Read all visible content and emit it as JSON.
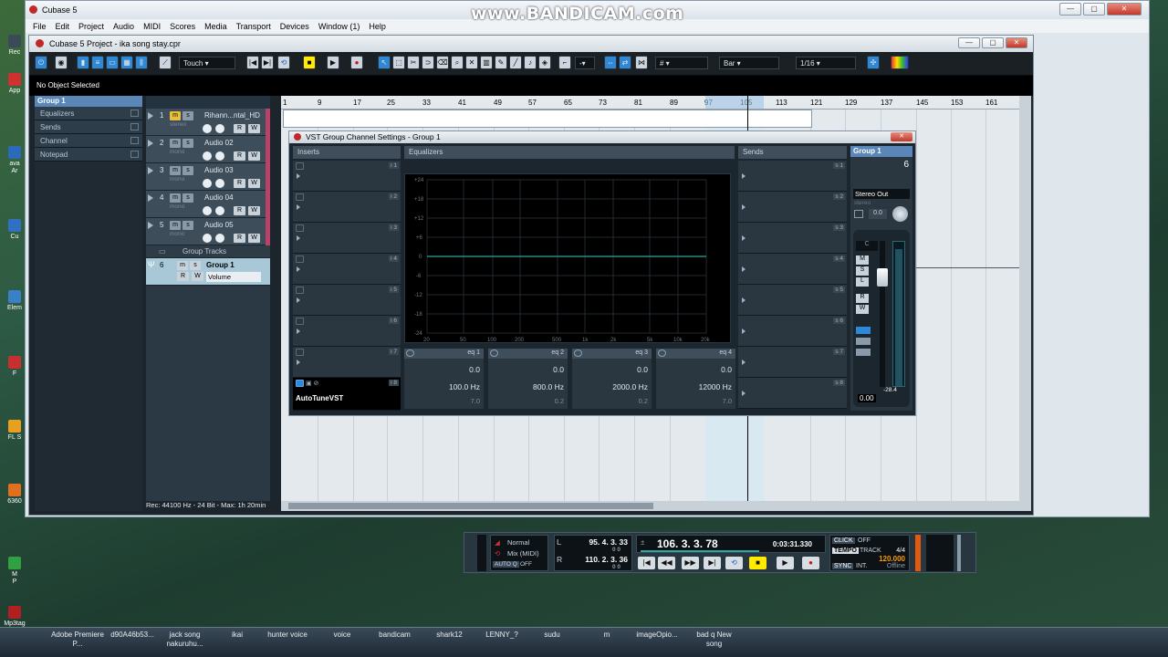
{
  "watermark": "www.BANDICAM.com",
  "app": {
    "title": "Cubase 5",
    "menu": [
      "File",
      "Edit",
      "Project",
      "Audio",
      "MIDI",
      "Scores",
      "Media",
      "Transport",
      "Devices",
      "Window (1)",
      "Help"
    ]
  },
  "desktop": {
    "labels": [
      "Rec",
      "App",
      "ava",
      "Ar",
      "Cu",
      "Elem",
      "F",
      "FL S",
      "6360",
      "M",
      "P",
      "Mp3tag"
    ]
  },
  "taskbar": [
    "Adobe Premiere P...",
    "d90A46b53...",
    "jack song nakuruhu...",
    "ikai",
    "hunter voice",
    "voice",
    "bandicam",
    "shark12",
    "LENNY_?",
    "sudu",
    "m",
    "imageOpio...",
    "bad q New song"
  ],
  "project": {
    "title": "Cubase 5 Project - ika song stay.cpr",
    "toolbar": {
      "automation_mode": "Touch",
      "grid_type": "Bar",
      "quantize": "1/16",
      "snap_value": "-"
    },
    "info_line": "No Object Selected",
    "inspector": {
      "header": "Group 1",
      "rows": [
        "Equalizers",
        "Sends",
        "Channel",
        "Notepad"
      ]
    },
    "status": "Rec: 44100 Hz - 24 Bit - Max: 1h 20min",
    "tracks": [
      {
        "num": "1",
        "name": "Rihann...ntal_HD",
        "type": "stereo"
      },
      {
        "num": "2",
        "name": "Audio 02",
        "type": "mono"
      },
      {
        "num": "3",
        "name": "Audio 03",
        "type": "mono"
      },
      {
        "num": "4",
        "name": "Audio 04",
        "type": "mono"
      },
      {
        "num": "5",
        "name": "Audio 05",
        "type": "mono"
      }
    ],
    "folder": "Group Tracks",
    "group_track": {
      "num": "6",
      "name": "Group 1",
      "param": "Volume"
    },
    "ruler": [
      "1",
      "9",
      "17",
      "25",
      "33",
      "41",
      "49",
      "57",
      "65",
      "73",
      "81",
      "89",
      "97",
      "105",
      "113",
      "121",
      "129",
      "137",
      "145",
      "153",
      "161"
    ]
  },
  "vst": {
    "title": "VST Group Channel Settings - Group 1",
    "inserts_label": "Inserts",
    "eq_label": "Equalizers",
    "sends_label": "Sends",
    "insert_slots": [
      "i 1",
      "i 2",
      "i 3",
      "i 4",
      "i 5",
      "i 6",
      "i 7",
      "i 8"
    ],
    "insert_plugin": "AutoTuneVST",
    "send_slots": [
      "s 1",
      "s 2",
      "s 3",
      "s 4",
      "s 5",
      "s 6",
      "s 7",
      "s 8"
    ],
    "eq_db_ticks": [
      "+24",
      "+18",
      "+12",
      "+6",
      "0",
      "-6",
      "-12",
      "-18",
      "-24"
    ],
    "eq_freq_ticks": [
      "20",
      "50",
      "100",
      "200",
      "500",
      "1k",
      "2k",
      "5k",
      "10k",
      "20k"
    ],
    "eq_bands": [
      {
        "label": "eq 1",
        "gain": "0.0",
        "freq": "100.0 Hz",
        "q": "7.0"
      },
      {
        "label": "eq 2",
        "gain": "0.0",
        "freq": "800.0 Hz",
        "q": "0.2"
      },
      {
        "label": "eq 3",
        "gain": "0.0",
        "freq": "2000.0 Hz",
        "q": "0.2"
      },
      {
        "label": "eq 4",
        "gain": "0.0",
        "freq": "12000 Hz",
        "q": "7.0"
      }
    ],
    "strip": {
      "name": "Group 1",
      "number": "6",
      "output": "Stereo Out",
      "output_type": "stereo",
      "pan_value": "0.0",
      "pan_center": "C",
      "peak": "-28.4",
      "fader": "0.00",
      "buttons": [
        "M",
        "S",
        "L",
        "R",
        "W"
      ]
    }
  },
  "transport": {
    "mode": "Normal",
    "mix": "Mix (MIDI)",
    "autoq": "AUTO Q",
    "autoq_state": "OFF",
    "left_locator": "95. 4. 3. 33",
    "right_locator": "110. 2. 3. 36",
    "left_sub": "0  0",
    "right_sub": "0  0",
    "position": "106. 3. 3. 78",
    "time": "0:03:31.330",
    "click": "CLICK",
    "click_state": "OFF",
    "tempo": "TEMPO",
    "track": "TRACK",
    "signature": "4/4",
    "bpm": "120.000",
    "sync": "SYNC",
    "sync_src": "INT.",
    "sync_state": "Offline"
  }
}
